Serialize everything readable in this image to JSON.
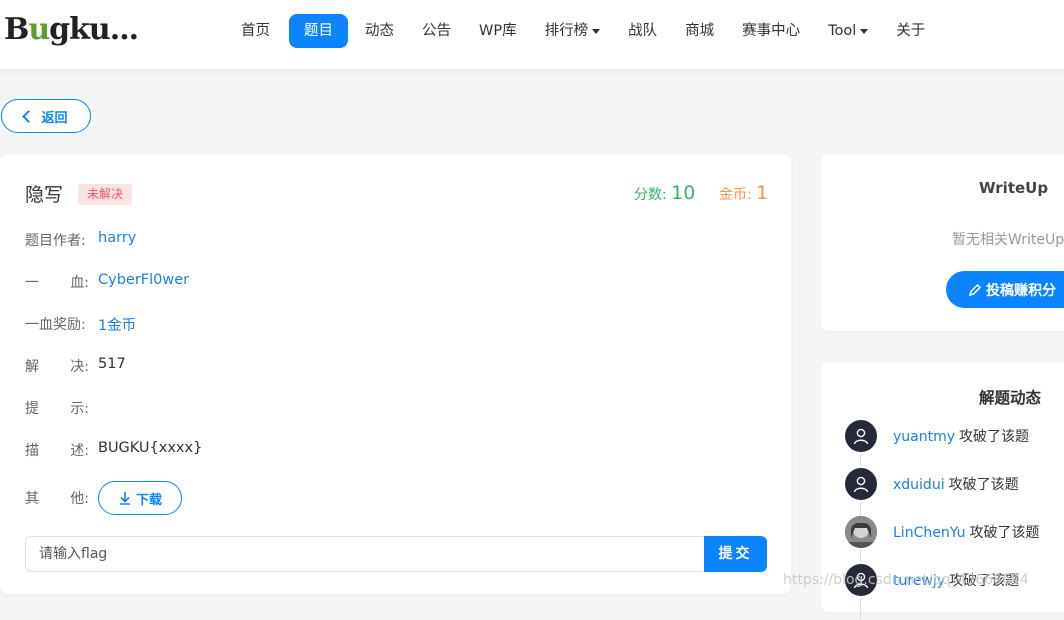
{
  "logo": {
    "text_b": "B",
    "text_g": "u",
    "text_rest": "gku..."
  },
  "nav": {
    "items": [
      {
        "label": "首页"
      },
      {
        "label": "题目",
        "active": true
      },
      {
        "label": "动态"
      },
      {
        "label": "公告"
      },
      {
        "label": "WP库"
      },
      {
        "label": "排行榜",
        "dropdown": true
      },
      {
        "label": "战队"
      },
      {
        "label": "商城"
      },
      {
        "label": "赛事中心"
      },
      {
        "label": "Tool",
        "dropdown": true
      },
      {
        "label": "关于"
      }
    ]
  },
  "back_label": "返回",
  "challenge": {
    "title": "隐写",
    "status": "未解决",
    "score_label": "分数:",
    "score": "10",
    "coin_label": "金币:",
    "coin": "1",
    "fields": [
      {
        "label_a": "题目作者:",
        "label_b": "",
        "value": "harry",
        "link": true
      },
      {
        "label_a": "一",
        "label_b": "血:",
        "value": "CyberFl0wer",
        "link": true
      },
      {
        "label_a": "一血奖励:",
        "label_b": "",
        "value": "1金币",
        "link": true
      },
      {
        "label_a": "解",
        "label_b": "决:",
        "value": "517",
        "link": false
      },
      {
        "label_a": "提",
        "label_b": "示:",
        "value": "",
        "link": false
      },
      {
        "label_a": "描",
        "label_b": "述:",
        "value": "BUGKU{xxxx}",
        "link": false
      },
      {
        "label_a": "其",
        "label_b": "他:",
        "value": "",
        "link": false
      }
    ],
    "download_label": "下载",
    "flag_placeholder": "请输入flag",
    "submit_label": "提交"
  },
  "writeup": {
    "title": "WriteUp",
    "empty_text": "暂无相关WriteUp",
    "submit_label": "投稿赚积分"
  },
  "activity": {
    "title": "解题动态",
    "items": [
      {
        "user": "yuantmy",
        "action": "攻破了该题",
        "avatar": "default"
      },
      {
        "user": "xduidui",
        "action": "攻破了该题",
        "avatar": "default"
      },
      {
        "user": "LinChenYu",
        "action": "攻破了该题",
        "avatar": "photo"
      },
      {
        "user": "turewjy",
        "action": "攻破了该题",
        "avatar": "default"
      }
    ]
  },
  "watermark": "https://blog.csdn.net/qq_43668604",
  "colors": {
    "accent": "#0b84ff",
    "score": "#33b46b",
    "coin": "#f0974b",
    "badge_bg": "#fde2e4",
    "badge_text": "#e45b6a"
  }
}
